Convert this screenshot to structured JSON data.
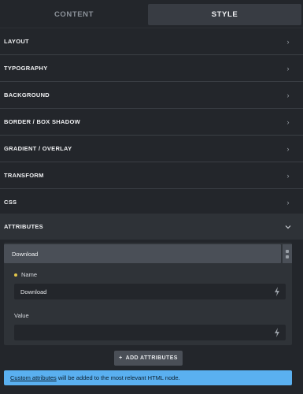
{
  "tabs": {
    "content": "CONTENT",
    "style": "STYLE",
    "active": "STYLE"
  },
  "sections": [
    {
      "label": "LAYOUT"
    },
    {
      "label": "TYPOGRAPHY"
    },
    {
      "label": "BACKGROUND"
    },
    {
      "label": "BORDER / BOX SHADOW"
    },
    {
      "label": "GRADIENT / OVERLAY"
    },
    {
      "label": "TRANSFORM"
    },
    {
      "label": "CSS"
    },
    {
      "label": "ATTRIBUTES",
      "expanded": true
    }
  ],
  "attributes": {
    "item_title": "Download",
    "name_label": "Name",
    "name_value": "Download",
    "value_label": "Value",
    "value_value": "",
    "add_button": "ADD ATTRIBUTES"
  },
  "notice": {
    "link_text": "Custom attributes",
    "text": " will be added to the most relevant HTML node."
  },
  "colors": {
    "background": "#23262b",
    "active_tab": "#383c43",
    "notice_bg": "#5ab0f0",
    "required_dot": "#e3c64a"
  },
  "icons": {
    "section_chevron": "chevron-right-icon",
    "expanded_chevron": "chevron-down-icon",
    "dynamic_data": "bolt-icon",
    "drag_handle": "drag-handle-icon",
    "add": "plus-icon"
  }
}
